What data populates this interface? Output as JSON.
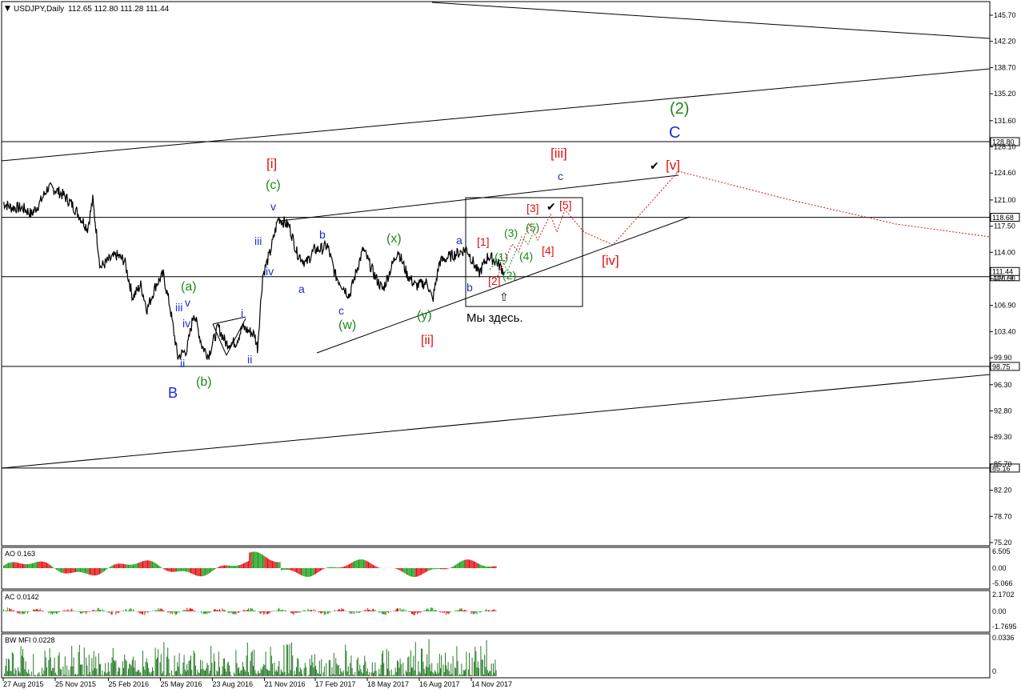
{
  "window": {
    "symbol_title": "USDJPY,Daily",
    "ohlc": "112.65 112.80 111.28 111.44",
    "collapse_icon": "triangle-down-icon"
  },
  "annotation": {
    "we_are_here": "Мы здесь.",
    "arrow_icon": "up-arrow-outline-icon",
    "check_icon": "checkmark-icon"
  },
  "chart_data": {
    "type": "line",
    "series_type": "ohlc-daily-price",
    "ylim": [
      75.2,
      147.0
    ],
    "price_ticks": [
      "145.70",
      "142.20",
      "138.70",
      "135.20",
      "131.60",
      "128.10",
      "124.60",
      "121.00",
      "117.50",
      "114.00",
      "110.50",
      "106.90",
      "103.40",
      "99.90",
      "96.30",
      "92.80",
      "89.30",
      "85.70",
      "82.20",
      "78.70",
      "75.20"
    ],
    "price_levels": [
      {
        "label": "128.80",
        "value": 128.8
      },
      {
        "label": "118.68",
        "value": 118.68
      },
      {
        "label": "110.74",
        "value": 110.74
      },
      {
        "label": "98.75",
        "value": 98.75
      },
      {
        "label": "85.16",
        "value": 85.16
      }
    ],
    "current_price_label": "111.44",
    "x_labels": [
      "27 Aug 2015",
      "25 Nov 2015",
      "25 Feb 2016",
      "25 May 2016",
      "23 Aug 2016",
      "21 Nov 2016",
      "17 Feb 2017",
      "18 May 2017",
      "16 Aug 2017",
      "14 Nov 2017"
    ],
    "price_path": [
      [
        "27 Aug 2015",
        120.6
      ],
      [
        "10 Sep 2015",
        120.0
      ],
      [
        "1 Oct 2015",
        119.9
      ],
      [
        "15 Oct 2015",
        119.1
      ],
      [
        "30 Oct 2015",
        120.7
      ],
      [
        "12 Nov 2015",
        122.6
      ],
      [
        "25 Nov 2015",
        122.4
      ],
      [
        "10 Dec 2015",
        121.6
      ],
      [
        "24 Dec 2015",
        120.4
      ],
      [
        "5 Jan 2016",
        119.0
      ],
      [
        "20 Jan 2016",
        117.2
      ],
      [
        "29 Jan 2016",
        121.0
      ],
      [
        "11 Feb 2016",
        112.0
      ],
      [
        "25 Feb 2016",
        112.9
      ],
      [
        "10 Mar 2016",
        113.6
      ],
      [
        "24 Mar 2016",
        112.9
      ],
      [
        "7 Apr 2016",
        108.0
      ],
      [
        "21 Apr 2016",
        109.6
      ],
      [
        "2 May 2016",
        106.4
      ],
      [
        "18 May 2016",
        109.8
      ],
      [
        "30 May 2016",
        111.0
      ],
      [
        "10 Jun 2016",
        107.0
      ],
      [
        "24 Jun 2016",
        100.0
      ],
      [
        "10 Jul 2016",
        101.0
      ],
      [
        "22 Jul 2016",
        106.0
      ],
      [
        "5 Aug 2016",
        101.5
      ],
      [
        "16 Aug 2016",
        100.2
      ],
      [
        "2 Sep 2016",
        104.0
      ],
      [
        "16 Sep 2016",
        101.8
      ],
      [
        "3 Oct 2016",
        102.0
      ],
      [
        "14 Oct 2016",
        104.0
      ],
      [
        "4 Nov 2016",
        103.0
      ],
      [
        "9 Nov 2016",
        101.2
      ],
      [
        "18 Nov 2016",
        110.9
      ],
      [
        "1 Dec 2016",
        114.0
      ],
      [
        "15 Dec 2016",
        118.6
      ],
      [
        "3 Jan 2017",
        117.5
      ],
      [
        "16 Jan 2017",
        114.0
      ],
      [
        "1 Feb 2017",
        112.5
      ],
      [
        "15 Feb 2017",
        114.3
      ],
      [
        "1 Mar 2017",
        114.5
      ],
      [
        "10 Mar 2017",
        114.9
      ],
      [
        "24 Mar 2017",
        110.9
      ],
      [
        "17 Apr 2017",
        108.2
      ],
      [
        "1 May 2017",
        112.0
      ],
      [
        "11 May 2017",
        114.4
      ],
      [
        "1 Jun 2017",
        110.7
      ],
      [
        "14 Jun 2017",
        109.0
      ],
      [
        "10 Jul 2017",
        114.3
      ],
      [
        "26 Jul 2017",
        111.0
      ],
      [
        "10 Aug 2017",
        109.5
      ],
      [
        "30 Aug 2017",
        110.0
      ],
      [
        "8 Sep 2017",
        107.5
      ],
      [
        "20 Sep 2017",
        112.7
      ],
      [
        "6 Oct 2017",
        113.4
      ],
      [
        "25 Oct 2017",
        114.0
      ],
      [
        "6 Nov 2017",
        114.5
      ],
      [
        "27 Nov 2017",
        111.1
      ],
      [
        "13 Dec 2017",
        113.5
      ],
      [
        "27 Dec 2017",
        112.8
      ],
      [
        "10 Jan 2018",
        111.4
      ]
    ],
    "indicators": [
      {
        "name": "AO",
        "value_text": "AO 0.163",
        "ticks": [
          "6.505",
          "0.00",
          "-5.066"
        ]
      },
      {
        "name": "AC",
        "value_text": "AC 0.0142",
        "ticks": [
          "2.1702",
          "0.00",
          "-1.7695"
        ]
      },
      {
        "name": "BW MFI",
        "value_text": "BW MFI 0.0228",
        "ticks": [
          "0.0336",
          "0"
        ]
      }
    ],
    "wave_labels": [
      {
        "text": "B",
        "color": "#1c2bd6"
      },
      {
        "text": "(b)",
        "color": "#1a8a1a"
      },
      {
        "text": "(a)",
        "color": "#1a8a1a"
      },
      {
        "text": "iii",
        "color": "#1c2bd6"
      },
      {
        "text": "v",
        "color": "#1c2bd6"
      },
      {
        "text": "iv",
        "color": "#1c2bd6"
      },
      {
        "text": "ii",
        "color": "#1c2bd6"
      },
      {
        "text": "i",
        "color": "#1c2bd6"
      },
      {
        "text": "ii",
        "color": "#1c2bd6"
      },
      {
        "text": "iii",
        "color": "#1c2bd6"
      },
      {
        "text": "iv",
        "color": "#1c2bd6"
      },
      {
        "text": "v",
        "color": "#1c2bd6"
      },
      {
        "text": "[i]",
        "color": "#e01010"
      },
      {
        "text": "(c)",
        "color": "#1a8a1a"
      },
      {
        "text": "a",
        "color": "#1c2bd6"
      },
      {
        "text": "b",
        "color": "#1c2bd6"
      },
      {
        "text": "c",
        "color": "#1c2bd6"
      },
      {
        "text": "(w)",
        "color": "#1a8a1a"
      },
      {
        "text": "(x)",
        "color": "#1a8a1a"
      },
      {
        "text": "(y)",
        "color": "#1a8a1a"
      },
      {
        "text": "[ii]",
        "color": "#e01010"
      },
      {
        "text": "a",
        "color": "#1c2bd6"
      },
      {
        "text": "b",
        "color": "#1c2bd6"
      },
      {
        "text": "[1]",
        "color": "#e01010"
      },
      {
        "text": "[2]",
        "color": "#e01010"
      },
      {
        "text": "(1)",
        "color": "#1a8a1a"
      },
      {
        "text": "(2)",
        "color": "#1a8a1a"
      },
      {
        "text": "(3)",
        "color": "#1a8a1a"
      },
      {
        "text": "(4)",
        "color": "#1a8a1a"
      },
      {
        "text": "(5)",
        "color": "#1a8a1a"
      },
      {
        "text": "[3]",
        "color": "#e01010"
      },
      {
        "text": "[4]",
        "color": "#e01010"
      },
      {
        "text": "[5]",
        "color": "#e01010"
      },
      {
        "text": "[iii]",
        "color": "#e01010"
      },
      {
        "text": "c",
        "color": "#1c2bd6"
      },
      {
        "text": "[iv]",
        "color": "#e01010"
      },
      {
        "text": "[v]",
        "color": "#e01010"
      },
      {
        "text": "C",
        "color": "#1c2bd6"
      },
      {
        "text": "(2)",
        "color": "#1a8a1a"
      }
    ],
    "colors": {
      "price": "#000000",
      "wave_red": "#e01010",
      "wave_green": "#1a8a1a",
      "wave_blue": "#1c2bd6",
      "bar_up": "#1aa01a",
      "bar_down": "#e01010",
      "mfi": "#2a7a2a"
    }
  }
}
